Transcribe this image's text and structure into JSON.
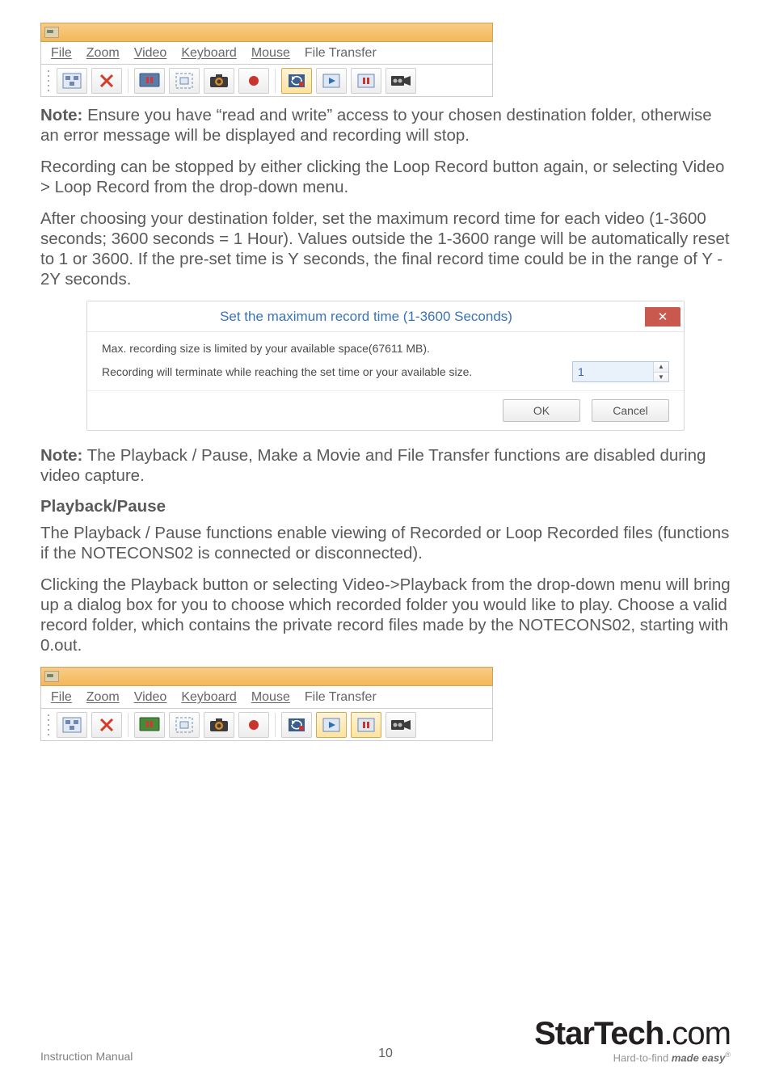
{
  "menu": {
    "file": "File",
    "zoom": "Zoom",
    "video": "Video",
    "keyboard": "Keyboard",
    "mouse": "Mouse",
    "filetransfer": "File Transfer"
  },
  "paras": {
    "note1_lead": "Note:",
    "note1_rest": " Ensure you have “read and write” access to your chosen destination folder, otherwise an error message will be displayed and recording will stop.",
    "p2": "Recording can be stopped by either clicking the Loop Record button again, or selecting Video > Loop Record from the drop-down menu.",
    "p3": "After choosing your destination folder, set the maximum record time for each video (1-3600 seconds; 3600 seconds = 1 Hour). Values outside the 1-3600 range will be automatically reset to 1 or 3600. If the pre-set time is Y seconds, the final record time could be in the range of Y - 2Y seconds.",
    "note2_lead": "Note:",
    "note2_rest": " The Playback / Pause, Make a Movie and File Transfer functions are disabled during video capture.",
    "h_playback": "Playback/Pause",
    "p4": "The Playback / Pause functions enable viewing of Recorded or Loop Recorded files (functions if the NOTECONS02 is connected or disconnected).",
    "p5": "Clicking the Playback button or selecting Video->Playback from the drop-down menu will bring up a dialog box for you to choose which recorded folder you would like to play. Choose a valid record folder, which contains the private record files made by the NOTECONS02, starting with 0.out."
  },
  "dialog": {
    "title": "Set the maximum record time (1-3600 Seconds)",
    "msg1": "Max. recording size is limited by your available space(67611 MB).",
    "msg2": "Recording will terminate while reaching the set time or your available size.",
    "value": "1",
    "ok": "OK",
    "cancel": "Cancel"
  },
  "footer": {
    "manual": "Instruction Manual",
    "page": "10",
    "brand_main": "StarTech",
    "brand_tail": ".com",
    "tagline_pre": "Hard-to-find ",
    "tagline_bold": "made easy"
  }
}
